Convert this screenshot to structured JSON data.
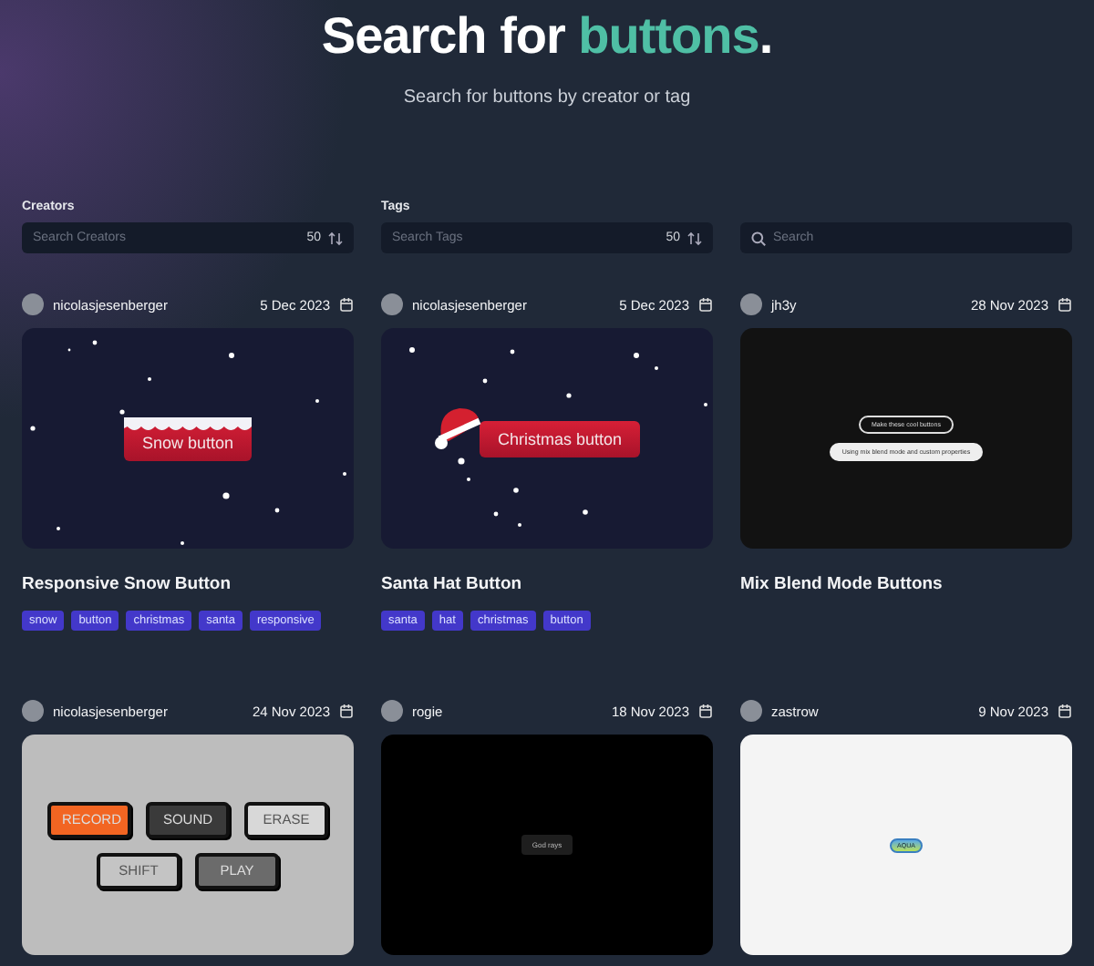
{
  "header": {
    "title": {
      "before": "Search for ",
      "highlight": "buttons",
      "after": "."
    },
    "subtitle": "Search for buttons by creator or tag"
  },
  "filters": [
    {
      "kind": "count",
      "label": "Creators",
      "placeholder": "Search Creators",
      "count": "50"
    },
    {
      "kind": "count",
      "label": "Tags",
      "placeholder": "Search Tags",
      "count": "50"
    },
    {
      "kind": "search",
      "placeholder": "Search"
    }
  ],
  "cards": [
    {
      "creator": "nicolasjesenberger",
      "date": "5 Dec 2023",
      "title": "Responsive Snow Button",
      "tags": [
        "snow",
        "button",
        "christmas",
        "santa",
        "responsive"
      ],
      "preview": {
        "kind": "snow",
        "labels": [
          "Snow button"
        ]
      }
    },
    {
      "creator": "nicolasjesenberger",
      "date": "5 Dec 2023",
      "title": "Santa Hat Button",
      "tags": [
        "santa",
        "hat",
        "christmas",
        "button"
      ],
      "preview": {
        "kind": "santa",
        "labels": [
          "Christmas button"
        ]
      }
    },
    {
      "creator": "jh3y",
      "date": "28 Nov 2023",
      "title": "Mix Blend Mode Buttons",
      "preview": {
        "kind": "blend",
        "labels": [
          "Make these cool buttons",
          "Using mix blend mode and custom properties"
        ]
      }
    },
    {
      "creator": "nicolasjesenberger",
      "date": "24 Nov 2023",
      "preview": {
        "kind": "keys",
        "keys": [
          {
            "label": "RECORD",
            "color": "#f26522"
          },
          {
            "label": "SOUND",
            "color": "#3a3a3a"
          },
          {
            "label": "ERASE",
            "color": "#d8d8d8"
          },
          {
            "label": "SHIFT",
            "color": "#c4c4c4"
          },
          {
            "label": "PLAY",
            "color": "#6b6b6b"
          }
        ]
      }
    },
    {
      "creator": "rogie",
      "date": "18 Nov 2023",
      "preview": {
        "kind": "rays",
        "labels": [
          "God rays"
        ]
      }
    },
    {
      "creator": "zastrow",
      "date": "9 Nov 2023",
      "preview": {
        "kind": "aqua",
        "labels": [
          "AQUA"
        ]
      }
    }
  ]
}
